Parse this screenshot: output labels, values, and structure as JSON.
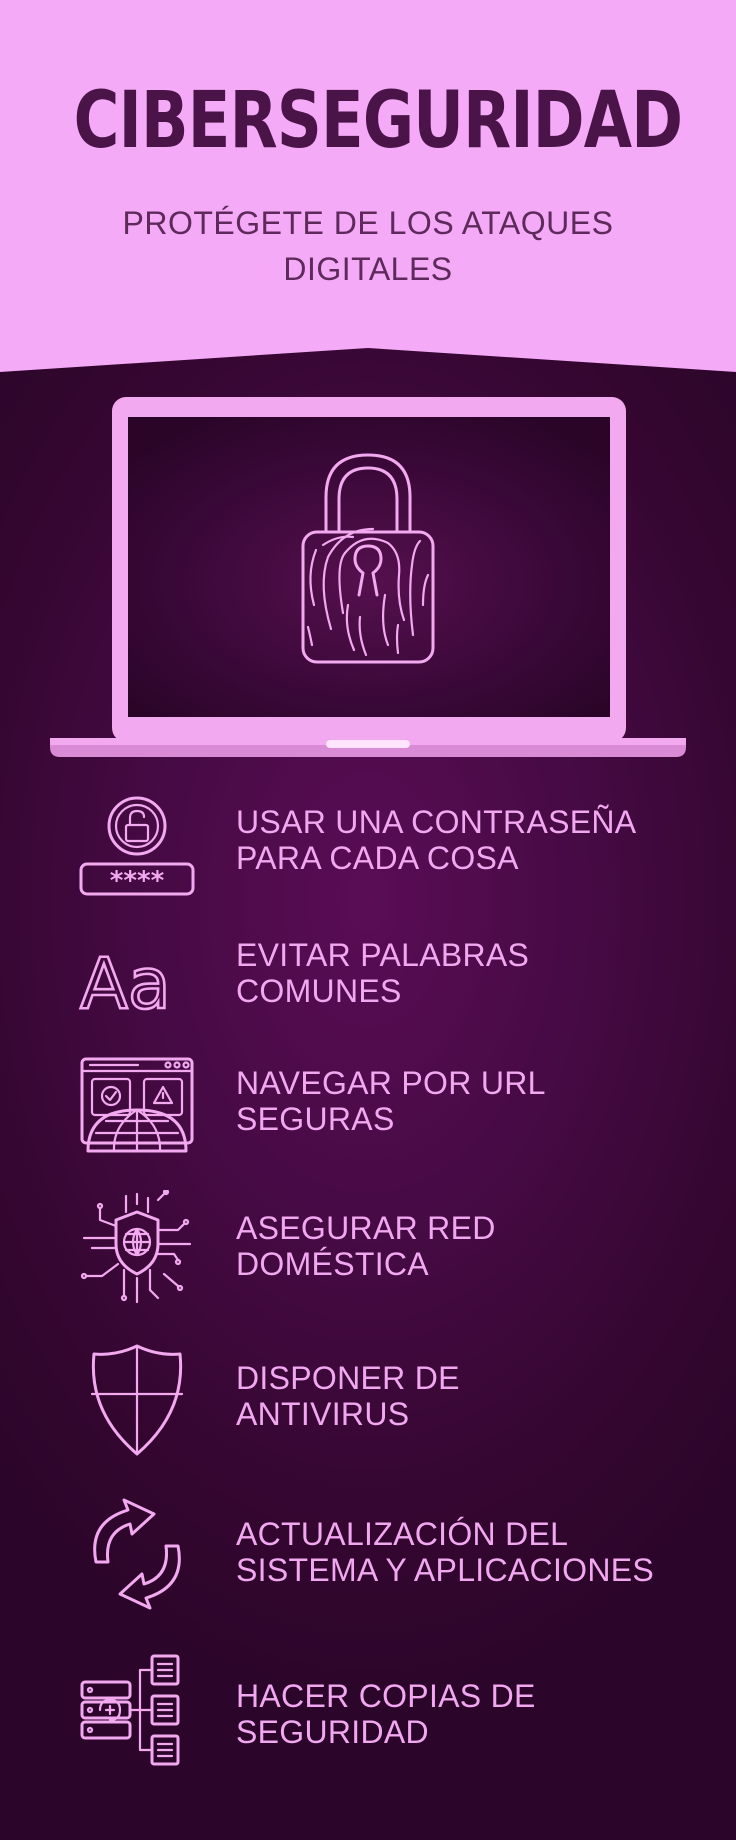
{
  "header": {
    "title": "CIBERSEGURIDAD",
    "subtitle": "PROTÉGETE DE LOS ATAQUES DIGITALES"
  },
  "colors": {
    "header_bg": "#f5aaf7",
    "dark_bg": "#3a0838",
    "accent": "#f2a9f0",
    "title": "#4a1448"
  },
  "hero": {
    "icon": "fingerprint-padlock-icon"
  },
  "tips": [
    {
      "icon": "password-lock-icon",
      "line1": "USAR UNA CONTRASEÑA",
      "line2": "PARA CADA COSA",
      "icon_text": "****"
    },
    {
      "icon": "font-icon",
      "line1": "EVITAR PALABRAS",
      "line2": "COMUNES",
      "icon_text": "Aa"
    },
    {
      "icon": "secure-browser-icon",
      "line1": "NAVEGAR POR URL",
      "line2": "SEGURAS"
    },
    {
      "icon": "network-shield-icon",
      "line1": "ASEGURAR RED",
      "line2": "DOMÉSTICA"
    },
    {
      "icon": "shield-icon",
      "line1": "DISPONER DE",
      "line2": "ANTIVIRUS"
    },
    {
      "icon": "sync-arrows-icon",
      "line1": "ACTUALIZACIÓN DEL",
      "line2": "SISTEMA Y APLICACIONES"
    },
    {
      "icon": "backup-server-icon",
      "line1": "HACER COPIAS DE",
      "line2": "SEGURIDAD"
    }
  ]
}
